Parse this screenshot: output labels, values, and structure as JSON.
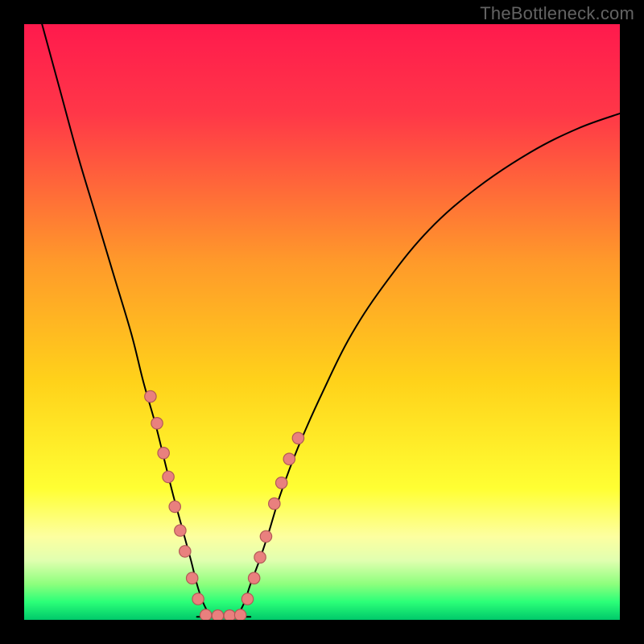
{
  "watermark": "TheBottleneck.com",
  "chart_data": {
    "type": "line",
    "title": "",
    "xlabel": "",
    "ylabel": "",
    "xlim": [
      0,
      100
    ],
    "ylim": [
      0,
      100
    ],
    "grid": false,
    "legend": false,
    "gradient_stops": [
      {
        "offset": 0,
        "color": "#ff1a4d"
      },
      {
        "offset": 0.15,
        "color": "#ff3748"
      },
      {
        "offset": 0.4,
        "color": "#ff9a2a"
      },
      {
        "offset": 0.6,
        "color": "#ffd21a"
      },
      {
        "offset": 0.78,
        "color": "#ffff33"
      },
      {
        "offset": 0.86,
        "color": "#fdffa0"
      },
      {
        "offset": 0.9,
        "color": "#e1ffb0"
      },
      {
        "offset": 0.94,
        "color": "#8dff7d"
      },
      {
        "offset": 0.97,
        "color": "#2bff78"
      },
      {
        "offset": 1.0,
        "color": "#00c96a"
      }
    ],
    "series": [
      {
        "name": "left-curve",
        "x": [
          3,
          6,
          9,
          12,
          15,
          18,
          20,
          22,
          23.5,
          25,
          26.5,
          28,
          29,
          30,
          31
        ],
        "values": [
          100,
          89,
          78,
          68,
          58,
          48,
          40,
          33,
          27,
          21,
          15.5,
          10,
          6,
          3,
          1
        ]
      },
      {
        "name": "right-curve",
        "x": [
          36,
          37,
          38,
          39.5,
          41,
          43,
          46,
          50,
          55,
          61,
          68,
          76,
          85,
          93,
          100
        ],
        "values": [
          1,
          3,
          6,
          10,
          14.5,
          21,
          29,
          38,
          48,
          57,
          65.5,
          72.5,
          78.5,
          82.5,
          85
        ]
      },
      {
        "name": "valley-floor",
        "x": [
          29,
          31,
          33.5,
          36,
          38
        ],
        "values": [
          0.5,
          0.5,
          0.5,
          0.5,
          0.5
        ]
      }
    ],
    "data_points": {
      "left_cluster": [
        {
          "x": 21.2,
          "y": 37.5
        },
        {
          "x": 22.3,
          "y": 33.0
        },
        {
          "x": 23.4,
          "y": 28.0
        },
        {
          "x": 24.2,
          "y": 24.0
        },
        {
          "x": 25.3,
          "y": 19.0
        },
        {
          "x": 26.2,
          "y": 15.0
        },
        {
          "x": 27.0,
          "y": 11.5
        },
        {
          "x": 28.2,
          "y": 7.0
        },
        {
          "x": 29.2,
          "y": 3.5
        }
      ],
      "right_cluster": [
        {
          "x": 37.5,
          "y": 3.5
        },
        {
          "x": 38.6,
          "y": 7.0
        },
        {
          "x": 39.6,
          "y": 10.5
        },
        {
          "x": 40.6,
          "y": 14.0
        },
        {
          "x": 42.0,
          "y": 19.5
        },
        {
          "x": 43.2,
          "y": 23.0
        },
        {
          "x": 44.5,
          "y": 27.0
        },
        {
          "x": 46.0,
          "y": 30.5
        }
      ],
      "bottom_cluster": [
        {
          "x": 30.5,
          "y": 0.8
        },
        {
          "x": 32.5,
          "y": 0.7
        },
        {
          "x": 34.5,
          "y": 0.7
        },
        {
          "x": 36.3,
          "y": 0.8
        }
      ]
    },
    "marker": {
      "r": 7.2,
      "fill": "#e9807e",
      "stroke": "#b25a56",
      "stroke_width": 1.2
    },
    "curve_stroke": {
      "color": "#000000",
      "width": 2
    }
  }
}
